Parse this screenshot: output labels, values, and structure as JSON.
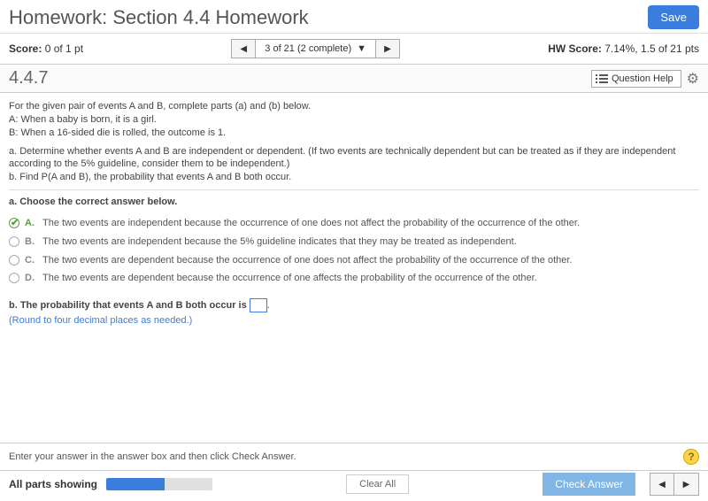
{
  "header": {
    "title": "Homework: Section 4.4 Homework",
    "save_label": "Save"
  },
  "scorebar": {
    "score_label": "Score:",
    "score_value": "0 of 1 pt",
    "nav_info": "3 of 21 (2 complete)",
    "hw_label": "HW Score:",
    "hw_value": "7.14%, 1.5 of 21 pts"
  },
  "qbar": {
    "number": "4.4.7",
    "help_label": "Question Help"
  },
  "problem": {
    "intro": "For the given pair of events A and B, complete parts (a) and (b) below.",
    "eventA": "A: When a baby is born, it is a girl.",
    "eventB": "B: When a 16-sided die is rolled, the outcome is 1.",
    "part_a_q": "a. Determine whether events A and B are independent or dependent. (If two events are technically dependent but can be treated as if they are independent according to the 5% guideline, consider them to be independent.)",
    "part_b_q": "b. Find P(A and B), the probability that events A and B both occur.",
    "part_a_prompt": "a. Choose the correct answer below.",
    "choices": [
      {
        "label": "A.",
        "text": "The two events are independent because the occurrence of one does not affect the probability of the occurrence of the other.",
        "selected": true
      },
      {
        "label": "B.",
        "text": "The two events are independent because the 5% guideline indicates that they may be treated as independent.",
        "selected": false
      },
      {
        "label": "C.",
        "text": "The two events are dependent because the occurrence of one does not affect the probability of the occurrence of the other.",
        "selected": false
      },
      {
        "label": "D.",
        "text": "The two events are dependent because the occurrence of one affects the probability of the occurrence of the other.",
        "selected": false
      }
    ],
    "part_b_text1": "b. The probability that events A and B both occur is ",
    "part_b_text2": ".",
    "part_b_hint": "(Round to four decimal places as needed.)"
  },
  "footer_hint": "Enter your answer in the answer box and then click Check Answer.",
  "footer": {
    "status": "All parts showing",
    "clear_label": "Clear All",
    "check_label": "Check Answer"
  }
}
